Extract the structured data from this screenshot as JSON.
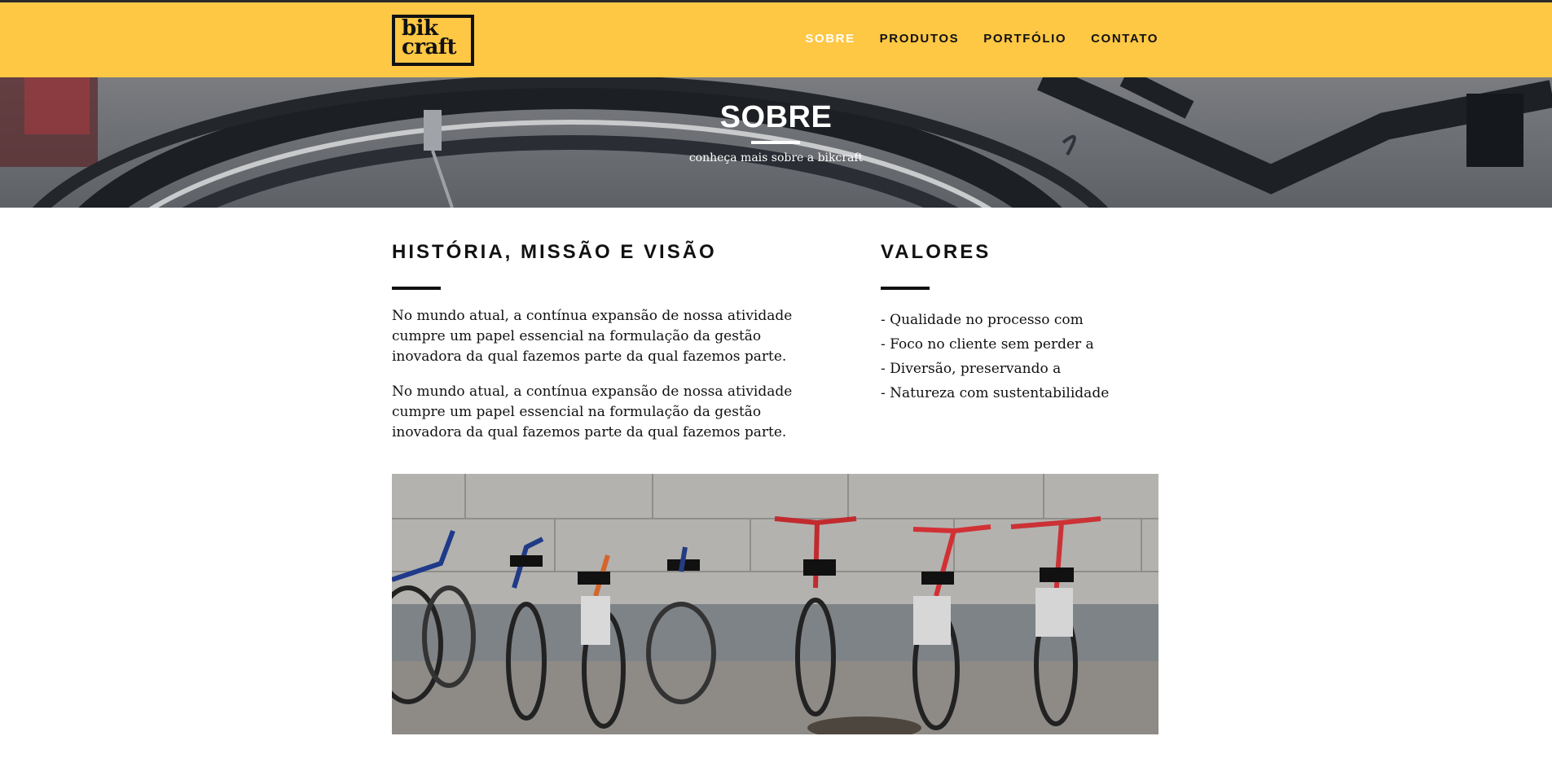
{
  "brand": {
    "logo_line1": "bik",
    "logo_line2": "craft",
    "color_primary": "#fec744",
    "color_text": "#111111"
  },
  "nav": {
    "items": [
      {
        "label": "SOBRE",
        "active": true
      },
      {
        "label": "PRODUTOS",
        "active": false
      },
      {
        "label": "PORTFÓLIO",
        "active": false
      },
      {
        "label": "CONTATO",
        "active": false
      }
    ]
  },
  "hero": {
    "title": "SOBRE",
    "subtitle": "conheça mais sobre a bikcraft"
  },
  "history": {
    "title": "HISTÓRIA, MISSÃO E VISÃO",
    "paragraphs": [
      "No mundo atual, a contínua expansão de nossa atividade cumpre um papel essencial na formulação da gestão inovadora da qual fazemos parte da qual fazemos parte.",
      "No mundo atual, a contínua expansão de nossa atividade cumpre um papel essencial na formulação da gestão inovadora da qual fazemos parte da qual fazemos parte."
    ]
  },
  "values": {
    "title": "VALORES",
    "items": [
      "- Qualidade no processo com",
      "- Foco no cliente sem perder a",
      "- Diversão, preservando a",
      "- Natureza com sustentabilidade"
    ]
  }
}
